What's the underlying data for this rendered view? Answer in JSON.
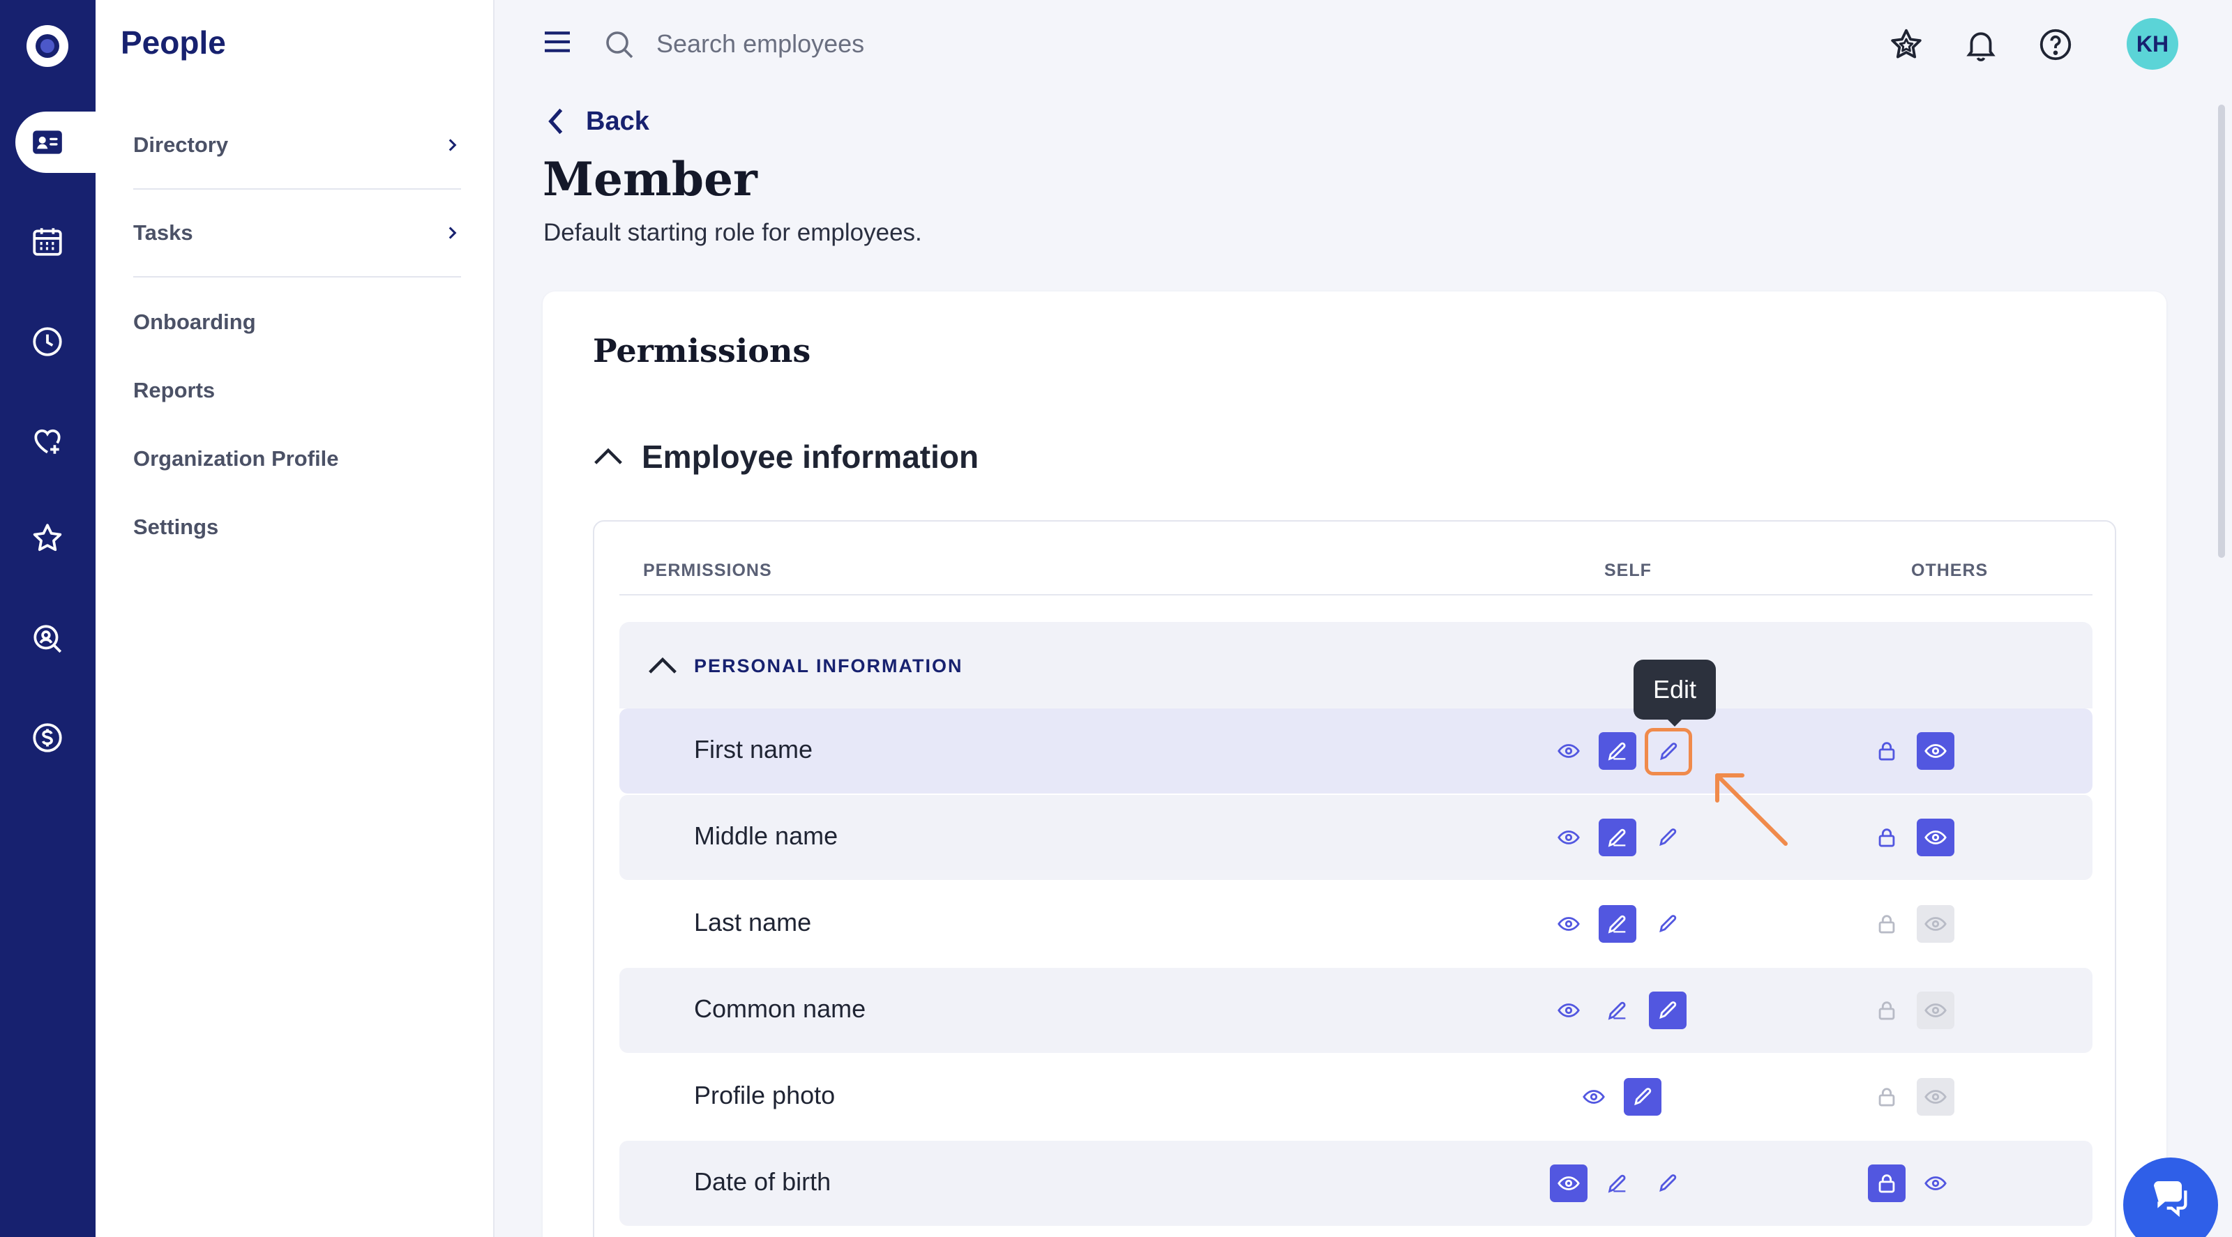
{
  "app": {
    "section_title": "People"
  },
  "rail": {
    "items": [
      {
        "icon": "logo-icon"
      },
      {
        "icon": "people-card-icon",
        "active": true
      },
      {
        "icon": "calendar-icon"
      },
      {
        "icon": "clock-icon"
      },
      {
        "icon": "heart-plus-icon"
      },
      {
        "icon": "star-icon"
      },
      {
        "icon": "search-person-icon"
      },
      {
        "icon": "dollar-icon"
      }
    ]
  },
  "sidenav": {
    "items": [
      {
        "label": "Directory",
        "has_children": true
      },
      {
        "label": "Tasks",
        "has_children": true
      },
      {
        "label": "Onboarding"
      },
      {
        "label": "Reports"
      },
      {
        "label": "Organization Profile"
      },
      {
        "label": "Settings"
      }
    ]
  },
  "topbar": {
    "search_placeholder": "Search employees",
    "avatar_initials": "KH"
  },
  "page": {
    "back_label": "Back",
    "title": "Member",
    "subtitle": "Default starting role for employees."
  },
  "permissions": {
    "title": "Permissions",
    "section_title": "Employee information",
    "columns": {
      "permissions": "PERMISSIONS",
      "self": "SELF",
      "others": "OTHERS"
    },
    "group_label": "PERSONAL INFORMATION",
    "tooltip": "Edit",
    "rows": [
      {
        "label": "First name",
        "self": "edit-limited",
        "others": "view",
        "others_enabled": true
      },
      {
        "label": "Middle name",
        "self": "edit-limited",
        "others": "view",
        "others_enabled": true
      },
      {
        "label": "Last name",
        "self": "edit-limited",
        "others": "view",
        "others_enabled": false
      },
      {
        "label": "Common name",
        "self": "edit",
        "others": "view",
        "others_enabled": false
      },
      {
        "label": "Profile photo",
        "self": "edit",
        "others": "view",
        "others_enabled": false
      },
      {
        "label": "Date of birth",
        "self": "view",
        "others": "locked",
        "others_enabled": true
      }
    ]
  },
  "colors": {
    "brand": "#17216f",
    "accent": "#5257e0",
    "highlight_outline": "#f08a4b",
    "avatar": "#5bd4d7"
  }
}
